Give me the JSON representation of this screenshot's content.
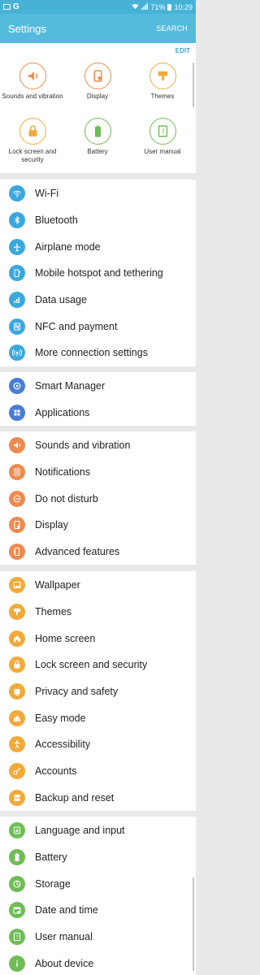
{
  "status_bar": {
    "left_glyph": "G",
    "battery": "71%",
    "time": "10:29"
  },
  "header": {
    "title": "Settings",
    "search": "SEARCH"
  },
  "quick": {
    "edit": "EDIT",
    "tiles": [
      {
        "label": "Sounds and vibration",
        "icon": "speaker-icon"
      },
      {
        "label": "Display",
        "icon": "display-icon"
      },
      {
        "label": "Themes",
        "icon": "themes-icon"
      },
      {
        "label": "Lock screen and security",
        "icon": "lock-icon"
      },
      {
        "label": "Battery",
        "icon": "battery-icon"
      },
      {
        "label": "User manual",
        "icon": "help-icon"
      }
    ]
  },
  "groups": [
    {
      "items": [
        {
          "label": "Wi-Fi",
          "icon": "wifi-icon",
          "color": "#3aa8de"
        },
        {
          "label": "Bluetooth",
          "icon": "bluetooth-icon",
          "color": "#3aa8de"
        },
        {
          "label": "Airplane mode",
          "icon": "airplane-icon",
          "color": "#3aa8de"
        },
        {
          "label": "Mobile hotspot and tethering",
          "icon": "hotspot-icon",
          "color": "#3aa8de"
        },
        {
          "label": "Data usage",
          "icon": "data-usage-icon",
          "color": "#3aa8de"
        },
        {
          "label": "NFC and payment",
          "icon": "nfc-icon",
          "color": "#3aa8de"
        },
        {
          "label": "More connection settings",
          "icon": "connection-icon",
          "color": "#3aa8de"
        }
      ]
    },
    {
      "items": [
        {
          "label": "Smart Manager",
          "icon": "smart-manager-icon",
          "color": "#4a7dd4"
        },
        {
          "label": "Applications",
          "icon": "apps-icon",
          "color": "#4a7dd4"
        }
      ]
    },
    {
      "items": [
        {
          "label": "Sounds and vibration",
          "icon": "speaker-icon",
          "color": "#ee8a50"
        },
        {
          "label": "Notifications",
          "icon": "notifications-icon",
          "color": "#ee8a50"
        },
        {
          "label": "Do not disturb",
          "icon": "do-not-disturb-icon",
          "color": "#ee8a50"
        },
        {
          "label": "Display",
          "icon": "display-icon",
          "color": "#ee8a50"
        },
        {
          "label": "Advanced features",
          "icon": "advanced-features-icon",
          "color": "#ee8a50"
        }
      ]
    },
    {
      "items": [
        {
          "label": "Wallpaper",
          "icon": "wallpaper-icon",
          "color": "#f2aa3a"
        },
        {
          "label": "Themes",
          "icon": "themes-icon",
          "color": "#f2aa3a"
        },
        {
          "label": "Home screen",
          "icon": "home-icon",
          "color": "#f2aa3a"
        },
        {
          "label": "Lock screen and security",
          "icon": "lock-icon",
          "color": "#f2aa3a"
        },
        {
          "label": "Privacy and safety",
          "icon": "privacy-icon",
          "color": "#f2aa3a"
        },
        {
          "label": "Easy mode",
          "icon": "easy-mode-icon",
          "color": "#f2aa3a"
        },
        {
          "label": "Accessibility",
          "icon": "accessibility-icon",
          "color": "#f2aa3a"
        },
        {
          "label": "Accounts",
          "icon": "key-icon",
          "color": "#f2aa3a"
        },
        {
          "label": "Backup and reset",
          "icon": "backup-icon",
          "color": "#f2aa3a"
        }
      ]
    },
    {
      "items": [
        {
          "label": "Language and input",
          "icon": "language-icon",
          "color": "#6ebd55"
        },
        {
          "label": "Battery",
          "icon": "battery-icon",
          "color": "#6ebd55"
        },
        {
          "label": "Storage",
          "icon": "storage-icon",
          "color": "#6ebd55"
        },
        {
          "label": "Date and time",
          "icon": "calendar-icon",
          "color": "#6ebd55"
        },
        {
          "label": "User manual",
          "icon": "help-icon",
          "color": "#6ebd55"
        },
        {
          "label": "About device",
          "icon": "info-icon",
          "color": "#6ebd55"
        }
      ]
    }
  ]
}
